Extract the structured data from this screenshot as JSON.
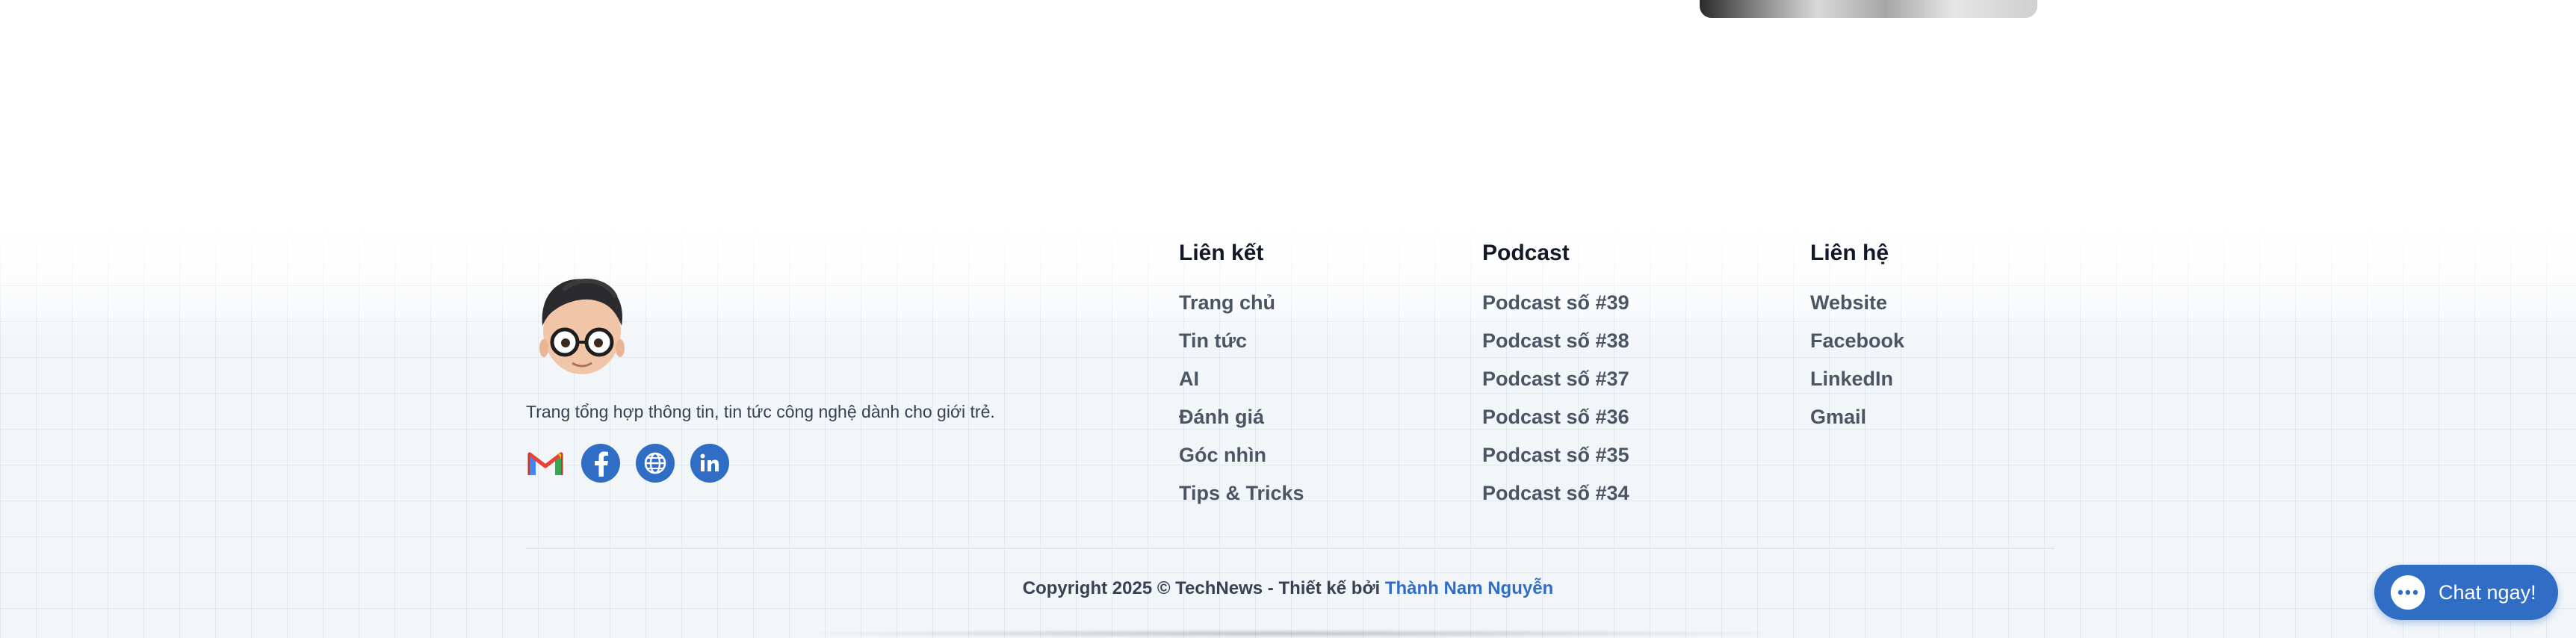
{
  "footer": {
    "tagline": "Trang tổng hợp thông tin, tin tức công nghệ dành cho giới trẻ.",
    "social_icons": [
      "gmail-icon",
      "facebook-icon",
      "globe-icon",
      "linkedin-icon"
    ],
    "columns": [
      {
        "title": "Liên kết",
        "links": [
          "Trang chủ",
          "Tin tức",
          "AI",
          "Đánh giá",
          "Góc nhìn",
          "Tips & Tricks"
        ]
      },
      {
        "title": "Podcast",
        "links": [
          "Podcast số #39",
          "Podcast số #38",
          "Podcast số #37",
          "Podcast số #36",
          "Podcast số #35",
          "Podcast số #34"
        ]
      },
      {
        "title": "Liên hệ",
        "links": [
          "Website",
          "Facebook",
          "LinkedIn",
          "Gmail"
        ]
      }
    ],
    "copyright_prefix": "Copyright 2025 © TechNews - Thiết kế bởi",
    "copyright_author": "Thành Nam Nguyễn"
  },
  "chat": {
    "label": "Chat ngay!"
  },
  "colors": {
    "accent": "#2f6ec4",
    "background": "#f3f6f9"
  }
}
